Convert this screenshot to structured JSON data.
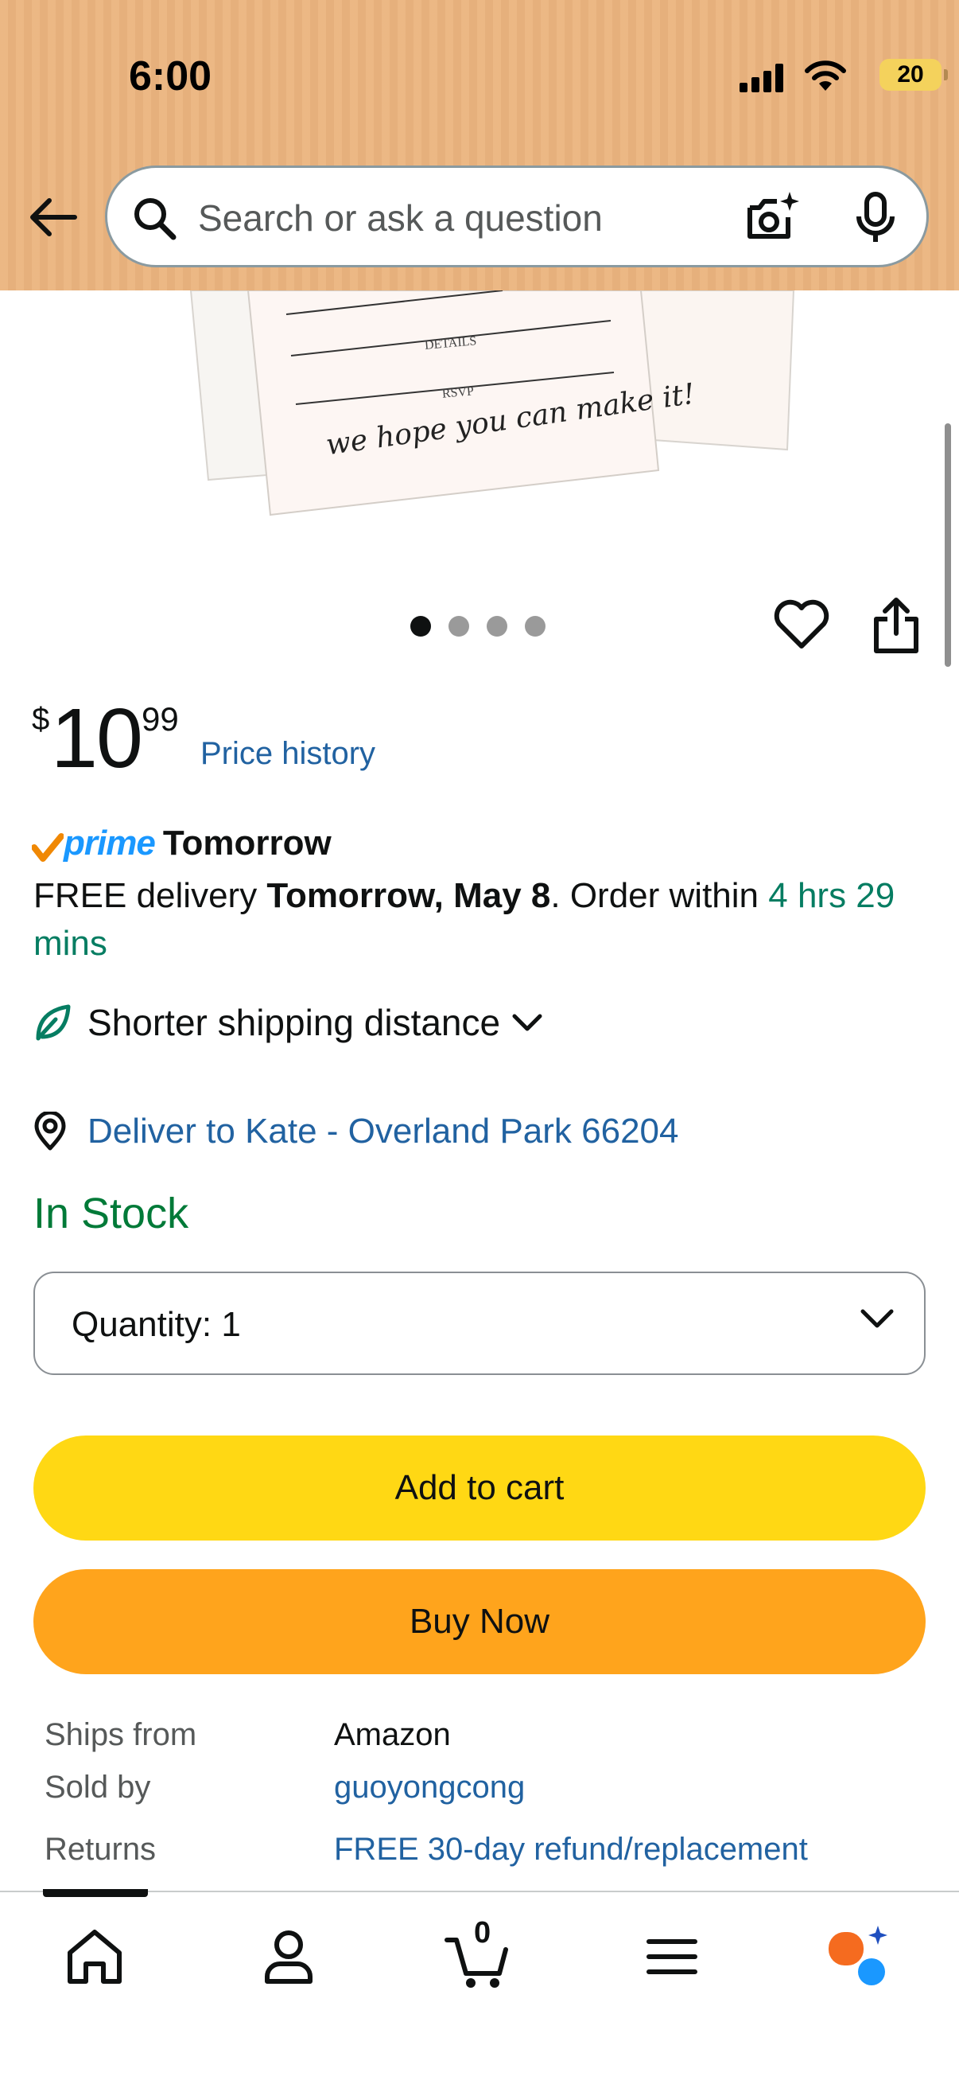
{
  "status_bar": {
    "time": "6:00",
    "battery": "20"
  },
  "search": {
    "placeholder": "Search or ask a question"
  },
  "product_image": {
    "card_lines": [
      "DETAILS",
      "RSVP"
    ],
    "script_text": "we hope you can make it!",
    "image_count": 4,
    "active_image": 1
  },
  "price": {
    "symbol": "$",
    "whole": "10",
    "fraction": "99",
    "history_link": "Price history"
  },
  "delivery": {
    "prime_label": "prime",
    "prime_day": "Tomorrow",
    "free_prefix": "FREE delivery ",
    "date": "Tomorrow, May 8",
    "order_within": ". Order within ",
    "countdown": "4 hrs 29 mins",
    "shipping_note": "Shorter shipping distance",
    "deliver_to": "Deliver to Kate - Overland Park 66204"
  },
  "stock_status": "In Stock",
  "quantity": {
    "label": "Quantity:",
    "value": "1"
  },
  "buttons": {
    "add_to_cart": "Add to cart",
    "buy_now": "Buy Now"
  },
  "info": [
    {
      "key": "Ships from",
      "value": "Amazon"
    },
    {
      "key": "Sold by",
      "value": "guoyongcong"
    },
    {
      "key": "Returns",
      "value": "FREE 30-day refund/replacement"
    }
  ],
  "bottom_nav": {
    "cart_count": "0"
  },
  "colors": {
    "header_bg": "#ebb47e",
    "link": "#2162a1",
    "in_stock": "#007a38",
    "countdown": "#067d62",
    "add_to_cart": "#ffd814",
    "buy_now": "#ffa41c",
    "prime_blue": "#1a98ff",
    "prime_check": "#f08804"
  }
}
